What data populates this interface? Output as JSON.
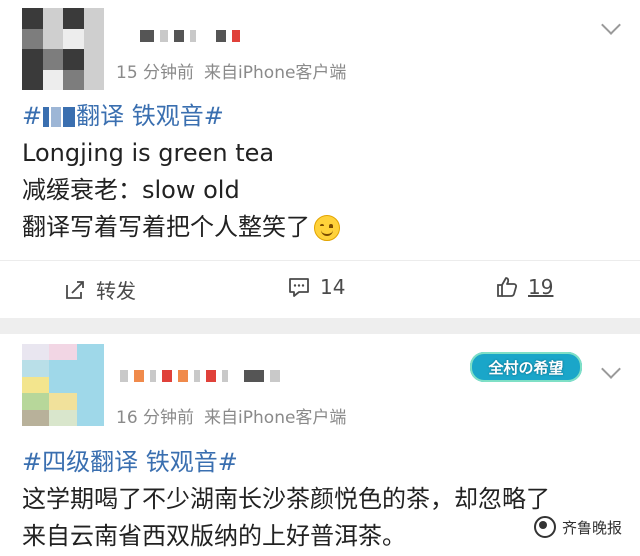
{
  "post1": {
    "time": "15 分钟前",
    "source": "来自iPhone客户端",
    "topic_tail": "翻译 铁观音#",
    "lines": [
      "Longjing is green tea",
      "减缓衰老：slow old",
      "翻译写着写着把个人整笑了"
    ],
    "actions": {
      "repost_label": "转发",
      "comment_count": "14",
      "like_count": "19"
    }
  },
  "post2": {
    "time": "16 分钟前",
    "source": "来自iPhone客户端",
    "badge": "全村の希望",
    "topic": "#四级翻译 铁观音#",
    "lines": [
      "这学期喝了不少湖南长沙茶颜悦色的茶，却忽略了",
      "来自云南省西双版纳的上好普洱茶。"
    ]
  },
  "watermark": "齐鲁晚报",
  "icons": {
    "more": "chevron-down-icon",
    "repost": "share-icon",
    "comment": "comment-icon",
    "like": "thumbs-up-icon",
    "emoji": "smile-emoji-icon"
  },
  "colors": {
    "topic": "#3a6fb0",
    "meta": "#8a8a8a",
    "separator": "#eeeeee"
  }
}
